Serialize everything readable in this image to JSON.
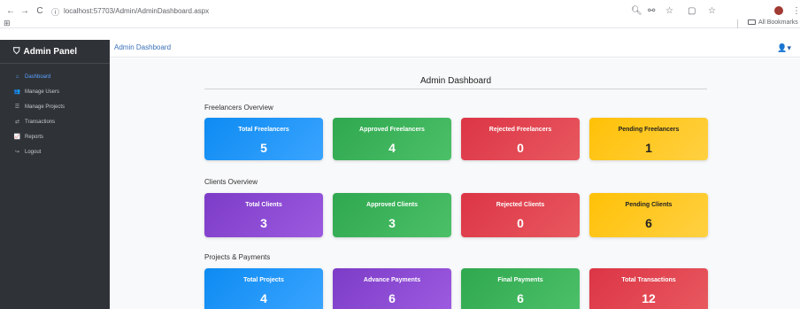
{
  "browser": {
    "back_icon": "←",
    "forward_icon": "→",
    "reload_icon": "C",
    "info_icon": "ⓘ",
    "url": "localhost:57703/Admin/AdminDashboard.aspx",
    "apps_icon": "⊞",
    "bookmarks_label": "All Bookmarks"
  },
  "sidebar": {
    "brand": "Admin Panel",
    "items": [
      {
        "label": "Dashboard",
        "icon": "home-icon",
        "glyph": "⌂"
      },
      {
        "label": "Manage Users",
        "icon": "users-icon",
        "glyph": "👥"
      },
      {
        "label": "Manage Projects",
        "icon": "list-icon",
        "glyph": "☰"
      },
      {
        "label": "Transactions",
        "icon": "exchange-icon",
        "glyph": "⇄"
      },
      {
        "label": "Reports",
        "icon": "chart-icon",
        "glyph": "📈"
      },
      {
        "label": "Logout",
        "icon": "logout-icon",
        "glyph": "↪"
      }
    ]
  },
  "topbar": {
    "breadcrumb": "Admin Dashboard"
  },
  "main": {
    "title": "Admin Dashboard",
    "sections": [
      {
        "title": "Freelancers Overview",
        "cards": [
          {
            "label": "Total Freelancers",
            "value": "5",
            "color": "#0d8bf2"
          },
          {
            "label": "Approved Freelancers",
            "value": "4",
            "color": "#2fa84f"
          },
          {
            "label": "Rejected Freelancers",
            "value": "0",
            "color": "#dc3545"
          },
          {
            "label": "Pending Freelancers",
            "value": "1",
            "color": "#ffc107"
          }
        ]
      },
      {
        "title": "Clients Overview",
        "cards": [
          {
            "label": "Total Clients",
            "value": "3",
            "color": "#7d3cc7"
          },
          {
            "label": "Approved Clients",
            "value": "3",
            "color": "#2fa84f"
          },
          {
            "label": "Rejected Clients",
            "value": "0",
            "color": "#dc3545"
          },
          {
            "label": "Pending Clients",
            "value": "6",
            "color": "#ffc107"
          }
        ]
      },
      {
        "title": "Projects & Payments",
        "cards": [
          {
            "label": "Total Projects",
            "value": "4",
            "color": "#0d8bf2"
          },
          {
            "label": "Advance Payments",
            "value": "6",
            "color": "#7d3cc7"
          },
          {
            "label": "Final Payments",
            "value": "6",
            "color": "#2fa84f"
          },
          {
            "label": "Total Transactions",
            "value": "12",
            "color": "#dc3545"
          }
        ]
      }
    ]
  }
}
